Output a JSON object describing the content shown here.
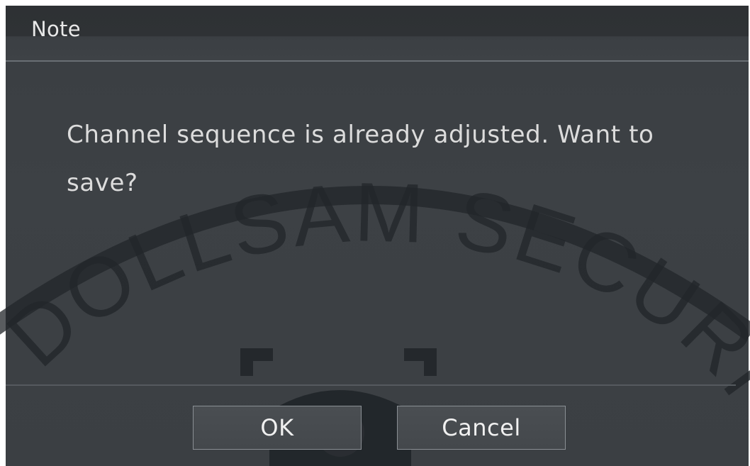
{
  "dialog": {
    "title": "Note",
    "message": "Channel sequence is already adjusted. Want to save?",
    "buttons": {
      "ok_label": "OK",
      "cancel_label": "Cancel"
    }
  },
  "watermark": {
    "text": "DOLLSAM SECURITY"
  },
  "colors": {
    "dialog_bg": "#3d4145",
    "title_bar": "#2f3235",
    "text": "#dcdcdc",
    "button_border": "#8a8f94",
    "watermark": "#1e2226"
  }
}
